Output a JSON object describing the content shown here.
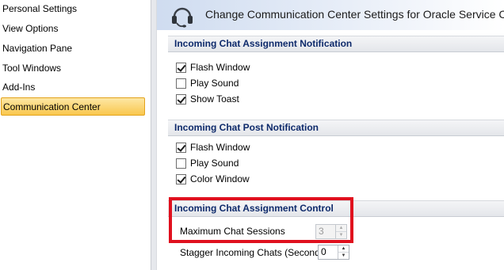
{
  "sidebar": {
    "items": [
      {
        "label": "Personal Settings",
        "selected": false
      },
      {
        "label": "View Options",
        "selected": false
      },
      {
        "label": "Navigation Pane",
        "selected": false
      },
      {
        "label": "Tool Windows",
        "selected": false
      },
      {
        "label": "Add-Ins",
        "selected": false
      },
      {
        "label": "Communication Center",
        "selected": true
      }
    ]
  },
  "header": {
    "title": "Change Communication Center Settings for Oracle Service Cloud",
    "icon": "headset-icon"
  },
  "sections": {
    "assignment_notification": {
      "title": "Incoming Chat Assignment Notification",
      "options": [
        {
          "label": "Flash Window",
          "checked": true
        },
        {
          "label": "Play Sound",
          "checked": false
        },
        {
          "label": "Show Toast",
          "checked": true
        }
      ]
    },
    "post_notification": {
      "title": "Incoming Chat Post Notification",
      "options": [
        {
          "label": "Flash Window",
          "checked": true
        },
        {
          "label": "Play Sound",
          "checked": false
        },
        {
          "label": "Color Window",
          "checked": true
        }
      ]
    },
    "assignment_control": {
      "title": "Incoming Chat Assignment Control",
      "max_sessions_label": "Maximum Chat Sessions",
      "max_sessions_value": "3",
      "stagger_label": "Stagger Incoming Chats (Seconds)",
      "stagger_value": "0"
    }
  },
  "colors": {
    "highlight": "#e0101e",
    "section_title": "#0e2a6b",
    "selected_item": "#f9c74e"
  }
}
